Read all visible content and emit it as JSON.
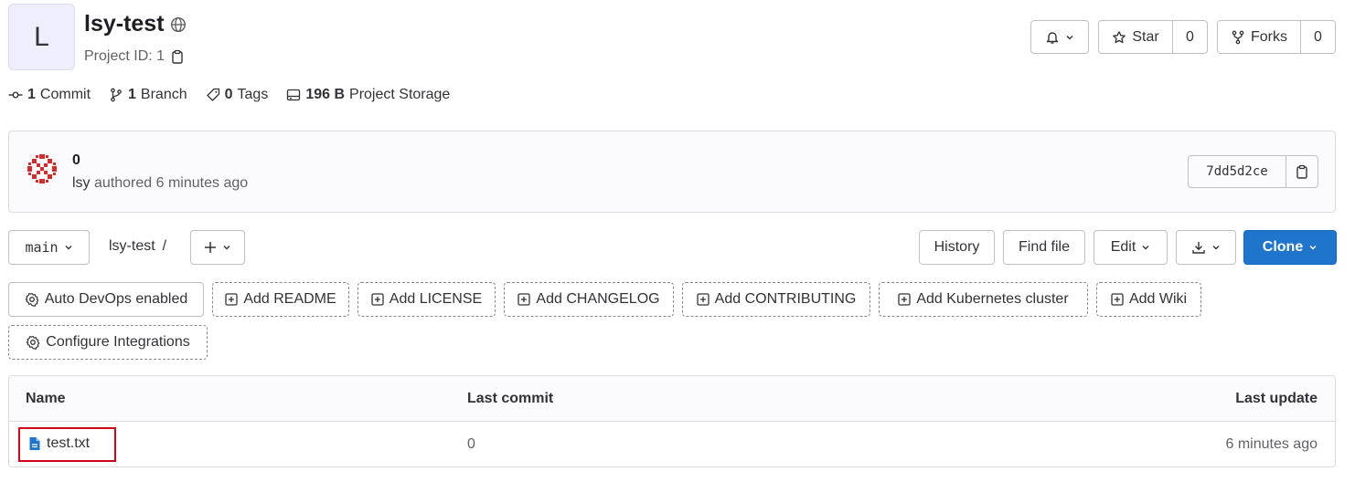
{
  "project": {
    "avatar_letter": "L",
    "name": "lsy-test",
    "visibility_icon": "globe-icon",
    "id_label": "Project ID: 1"
  },
  "actions": {
    "star_label": "Star",
    "star_count": "0",
    "forks_label": "Forks",
    "forks_count": "0"
  },
  "stats": {
    "commits_count": "1",
    "commits_label": "Commit",
    "branches_count": "1",
    "branches_label": "Branch",
    "tags_count": "0",
    "tags_label": "Tags",
    "storage_size": "196 B",
    "storage_label": "Project Storage"
  },
  "last_commit": {
    "title": "0",
    "author": "lsy",
    "meta": "authored 6 minutes ago",
    "sha": "7dd5d2ce"
  },
  "toolbar": {
    "branch": "main",
    "path_root": "lsy-test",
    "path_sep": "/",
    "history": "History",
    "find_file": "Find file",
    "edit": "Edit",
    "clone": "Clone"
  },
  "suggestions": [
    "Auto DevOps enabled",
    "Add README",
    "Add LICENSE",
    "Add CHANGELOG",
    "Add CONTRIBUTING",
    "Add Kubernetes cluster",
    "Add Wiki",
    "Configure Integrations"
  ],
  "table": {
    "headers": {
      "name": "Name",
      "last_commit": "Last commit",
      "last_update": "Last update"
    },
    "rows": [
      {
        "name": "test.txt",
        "last_commit": "0",
        "last_update": "6 minutes ago"
      }
    ]
  },
  "colors": {
    "primary": "#1f75cb",
    "highlight": "#d0021b"
  }
}
